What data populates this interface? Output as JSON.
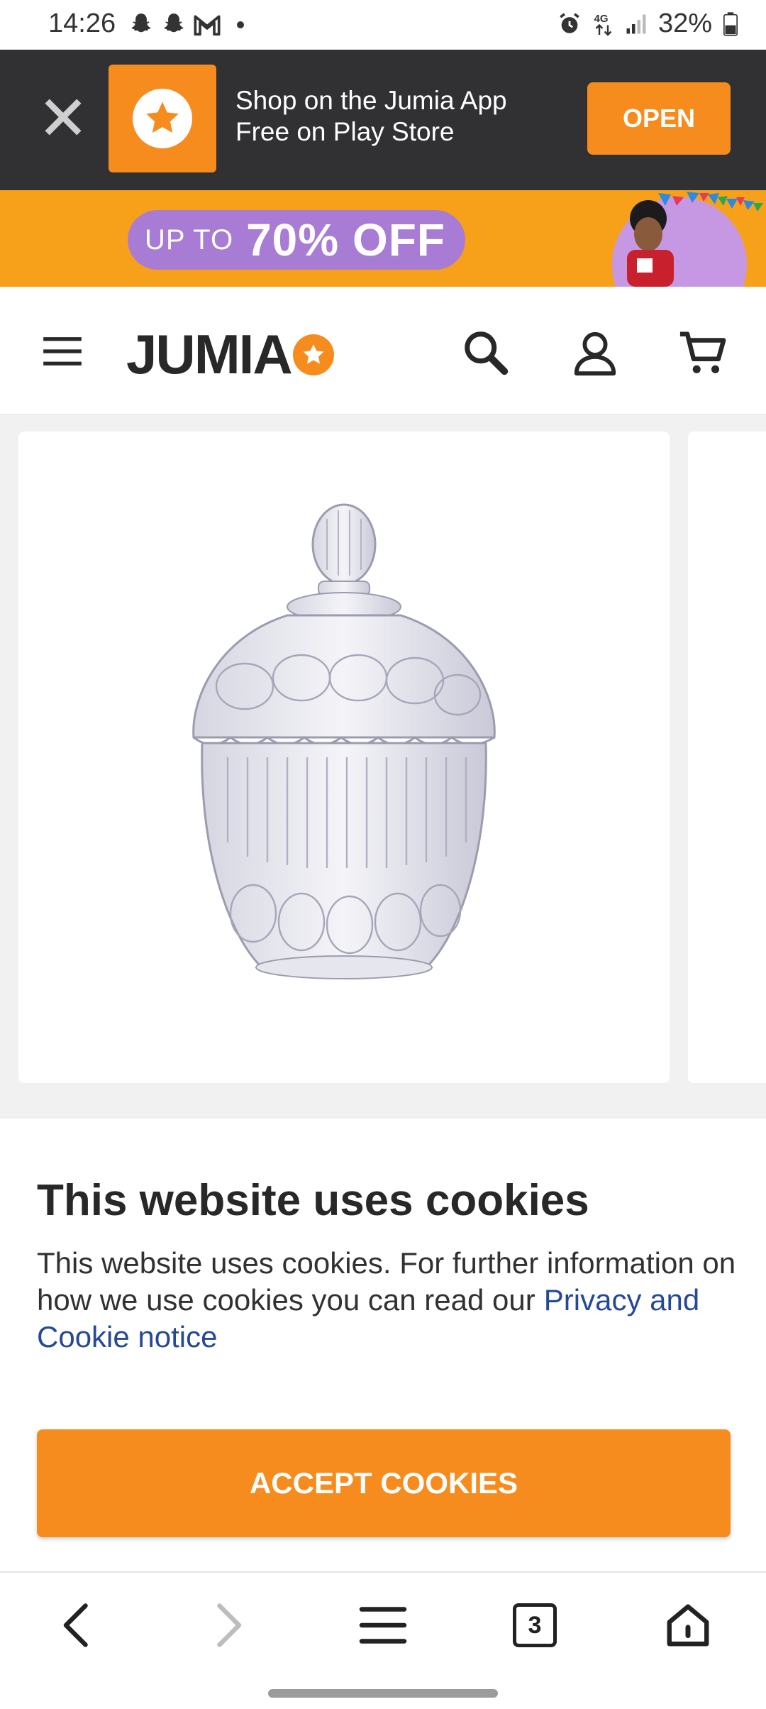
{
  "status_bar": {
    "time": "14:26",
    "network": "4G",
    "battery": "32%",
    "left_icons": [
      "snapchat-icon",
      "snapchat-icon",
      "gmail-icon"
    ],
    "right_icons": [
      "alarm-icon",
      "network-4g-icon",
      "signal-icon",
      "battery-icon"
    ]
  },
  "app_banner": {
    "line1": "Shop on the Jumia App",
    "line2": "Free on Play Store",
    "open_label": "OPEN",
    "accent": "#f68b1e",
    "background": "#313133"
  },
  "promo": {
    "prefix": "UP TO",
    "headline": "70% OFF",
    "background": "#f7a11b",
    "pill_color": "#a87cd4"
  },
  "header": {
    "logo_text": "JUMIA",
    "icons": [
      "menu-icon",
      "search-icon",
      "account-icon",
      "cart-icon"
    ]
  },
  "product": {
    "image": "crystal-glass-sugar-bowl"
  },
  "cookies": {
    "title": "This website uses cookies",
    "body": "This website uses cookies. For further information on how we use cookies you can read our",
    "link_text": "Privacy and Cookie notice",
    "accept_label": "ACCEPT COOKIES",
    "link_color": "#264996"
  },
  "browser_bar": {
    "tab_count": "3",
    "icons": [
      "back-icon",
      "forward-icon",
      "menu-icon",
      "tabs-icon",
      "home-icon"
    ]
  }
}
